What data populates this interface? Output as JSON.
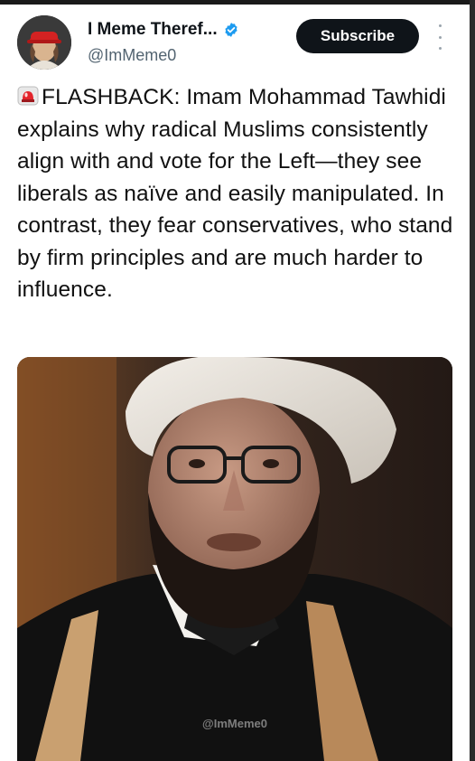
{
  "post": {
    "author_name": "I Meme Theref...",
    "author_handle": "@ImMeme0",
    "subscribe_label": "Subscribe",
    "badge_emoji": "siren",
    "text": "FLASHBACK: Imam Mohammad Tawhidi explains why radical Muslims consistently align with and vote for the Left—they see liberals as naïve and easily manipulated. In contrast, they fear conservatives, who stand by firm principles and are much harder to influence.",
    "media_watermark": "@ImMeme0"
  },
  "colors": {
    "verified": "#1d9bf0",
    "subscribe_bg": "#0f1419",
    "handle": "#536471"
  }
}
